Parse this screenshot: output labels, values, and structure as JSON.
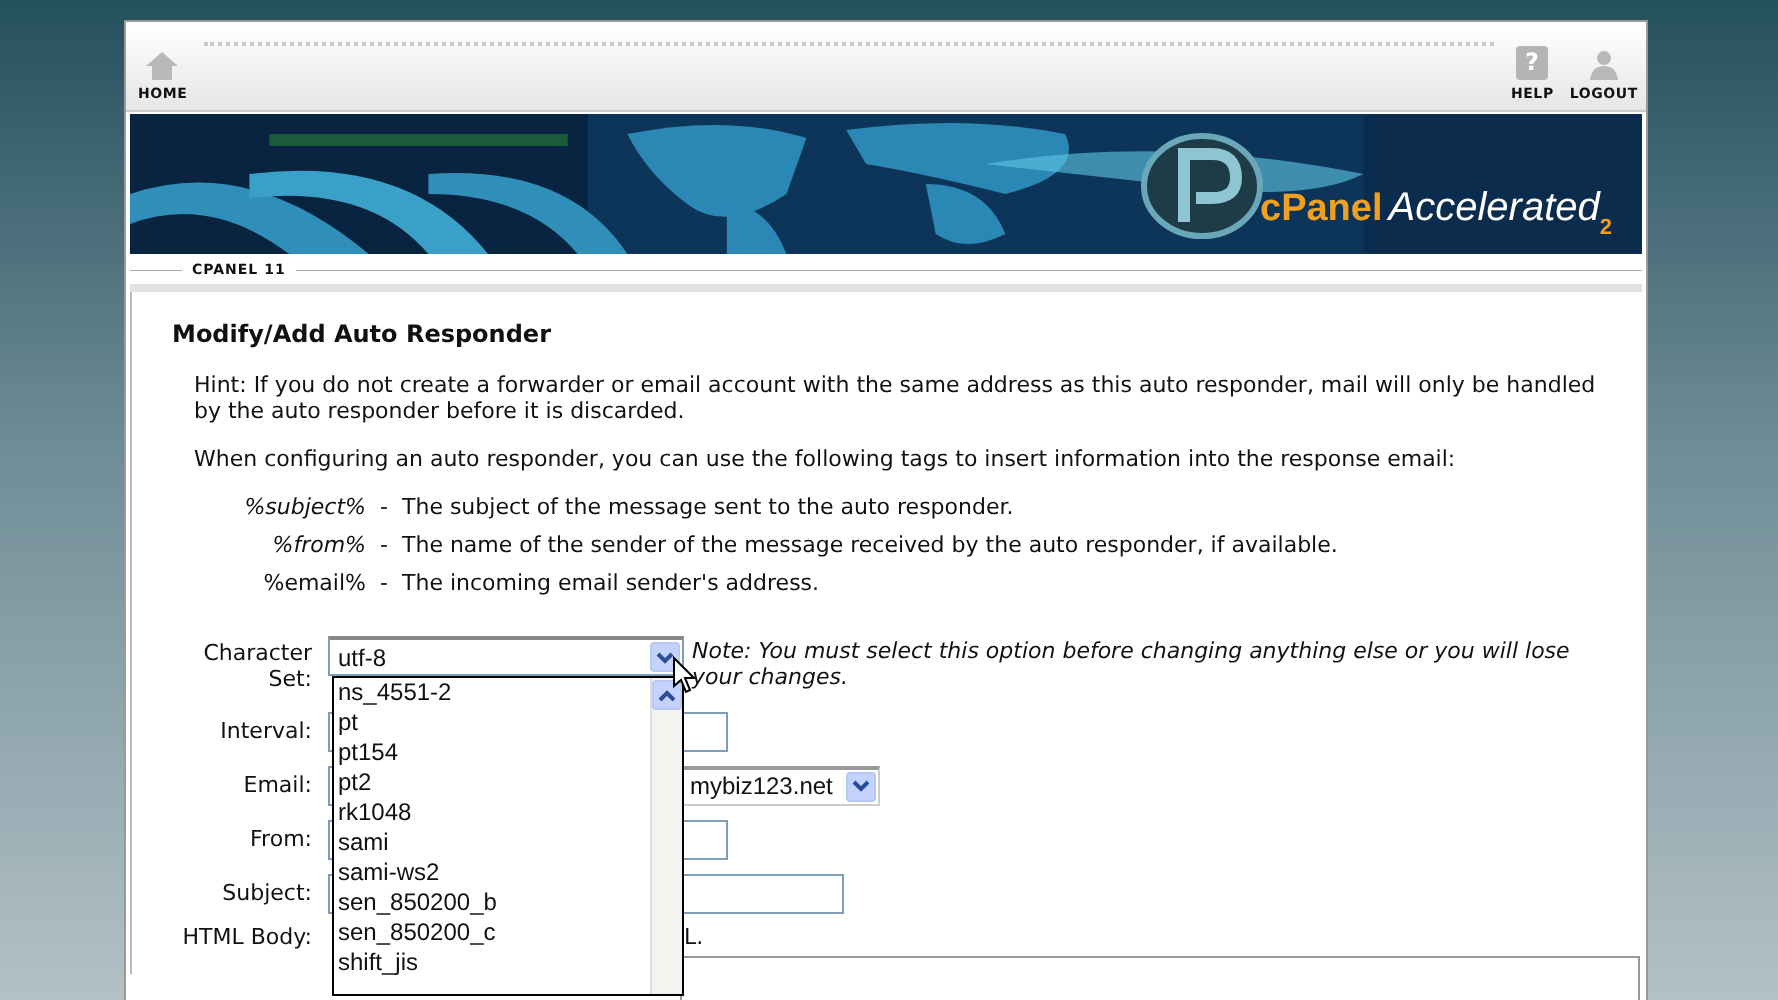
{
  "nav": {
    "home": "HOME",
    "help": "HELP",
    "help_glyph": "?",
    "logout": "LOGOUT"
  },
  "banner": {
    "logo_brand": "cPanel",
    "logo_product": "Accelerated",
    "logo_version": "2"
  },
  "breadcrumb": "CPANEL 11",
  "page_title": "Modify/Add Auto Responder",
  "hint": "Hint: If you do not create a forwarder or email account with the same address as this auto responder, mail will only be handled by the auto responder before it is discarded.",
  "tags_intro": "When configuring an auto responder, you can use the following tags to insert information into the response email:",
  "tags": [
    {
      "tag": "%subject%",
      "italic": true,
      "separator": "-",
      "description": "The subject of the message sent to the auto responder."
    },
    {
      "tag": "%from%",
      "italic": true,
      "separator": "-",
      "description": "The name of the sender of the message received by the auto responder, if available."
    },
    {
      "tag": "%email%",
      "italic": false,
      "separator": "-",
      "description": "The incoming email sender's address."
    }
  ],
  "form": {
    "character_set": {
      "label": "Character Set:",
      "value": "utf-8",
      "expanded": true,
      "note": "Note: You must select this option before changing anything else or you will lose your changes.",
      "options": [
        "ns_4551-2",
        "pt",
        "pt154",
        "pt2",
        "rk1048",
        "sami",
        "sami-ws2",
        "sen_850200_b",
        "sen_850200_c",
        "shift_jis"
      ]
    },
    "interval_label": "Interval:",
    "email_label": "Email:",
    "email_domain": "mybiz123.net",
    "from_label": "From:",
    "subject_label": "Subject:",
    "html_body_label": "HTML Body:",
    "html_note": "L."
  }
}
